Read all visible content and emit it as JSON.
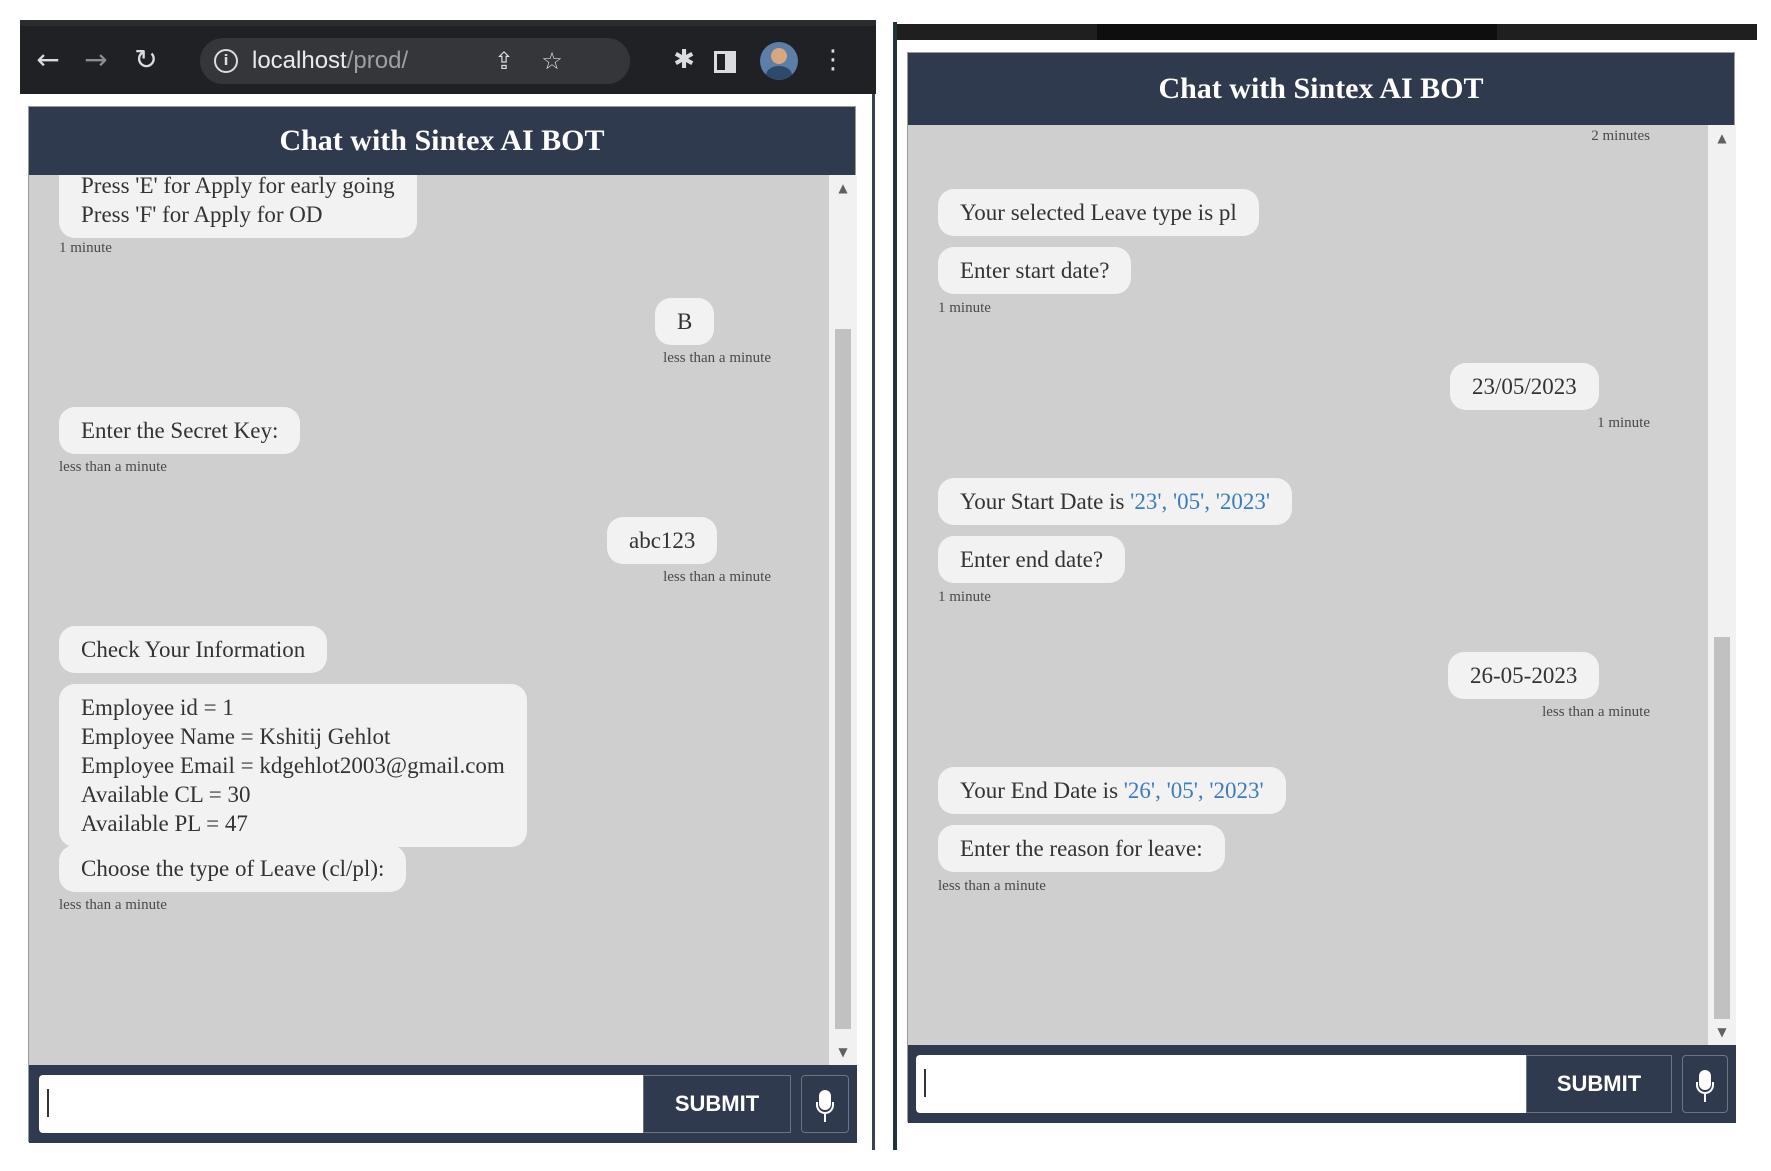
{
  "left": {
    "browser": {
      "url_host": "localhost",
      "url_path": "/prod/",
      "icons": [
        "back-arrow-icon",
        "forward-arrow-icon",
        "reload-icon",
        "site-info-icon",
        "share-icon",
        "bookmark-star-icon",
        "extensions-puzzle-icon",
        "side-panel-icon",
        "profile-avatar",
        "kebab-menu-icon"
      ]
    },
    "chat": {
      "title": "Chat with Sintex AI BOT",
      "messages": [
        {
          "from": "bot",
          "lines": [
            "Press 'E' for Apply for early going",
            "Press 'F' for Apply for OD"
          ],
          "time": "1 minute"
        },
        {
          "from": "user",
          "lines": [
            "B"
          ],
          "time": "less than a minute"
        },
        {
          "from": "bot",
          "lines": [
            "Enter the Secret Key:"
          ],
          "time": "less than a minute"
        },
        {
          "from": "user",
          "lines": [
            "abc123"
          ],
          "time": "less than a minute"
        },
        {
          "from": "bot",
          "lines": [
            "Check Your Information"
          ]
        },
        {
          "from": "bot",
          "lines": [
            "Employee id = 1",
            "Employee Name = Kshitij Gehlot",
            "Employee Email = kdgehlot2003@gmail.com",
            "Available CL = 30",
            "Available PL = 47"
          ]
        },
        {
          "from": "bot",
          "lines": [
            "Choose the type of Leave (cl/pl):"
          ],
          "time": "less than a minute"
        }
      ],
      "input_value": "",
      "submit_label": "SUBMIT"
    }
  },
  "right": {
    "chat": {
      "title": "Chat with Sintex AI BOT",
      "top_time": "2 minutes",
      "messages": [
        {
          "from": "bot",
          "text": "Your selected Leave type is pl"
        },
        {
          "from": "bot",
          "text": "Enter start date?",
          "time": "1 minute"
        },
        {
          "from": "user",
          "text": "23/05/2023",
          "time": "1 minute"
        },
        {
          "from": "bot",
          "prefix": "Your Start Date is ",
          "highlight": "'23', '05', '2023'"
        },
        {
          "from": "bot",
          "text": "Enter end date?",
          "time": "1 minute"
        },
        {
          "from": "user",
          "text": "26-05-2023",
          "time": "less than a minute"
        },
        {
          "from": "bot",
          "prefix": "Your End Date is ",
          "highlight": "'26', '05', '2023'"
        },
        {
          "from": "bot",
          "text": "Enter the reason for leave:",
          "time": "less than a minute"
        }
      ],
      "input_value": "",
      "submit_label": "SUBMIT"
    }
  },
  "colors": {
    "header": "#303a4e",
    "chat_bg": "#cfcfcf",
    "bubble": "#f2f2f2",
    "link": "#3a7dbd",
    "browser_bar": "#202124"
  }
}
